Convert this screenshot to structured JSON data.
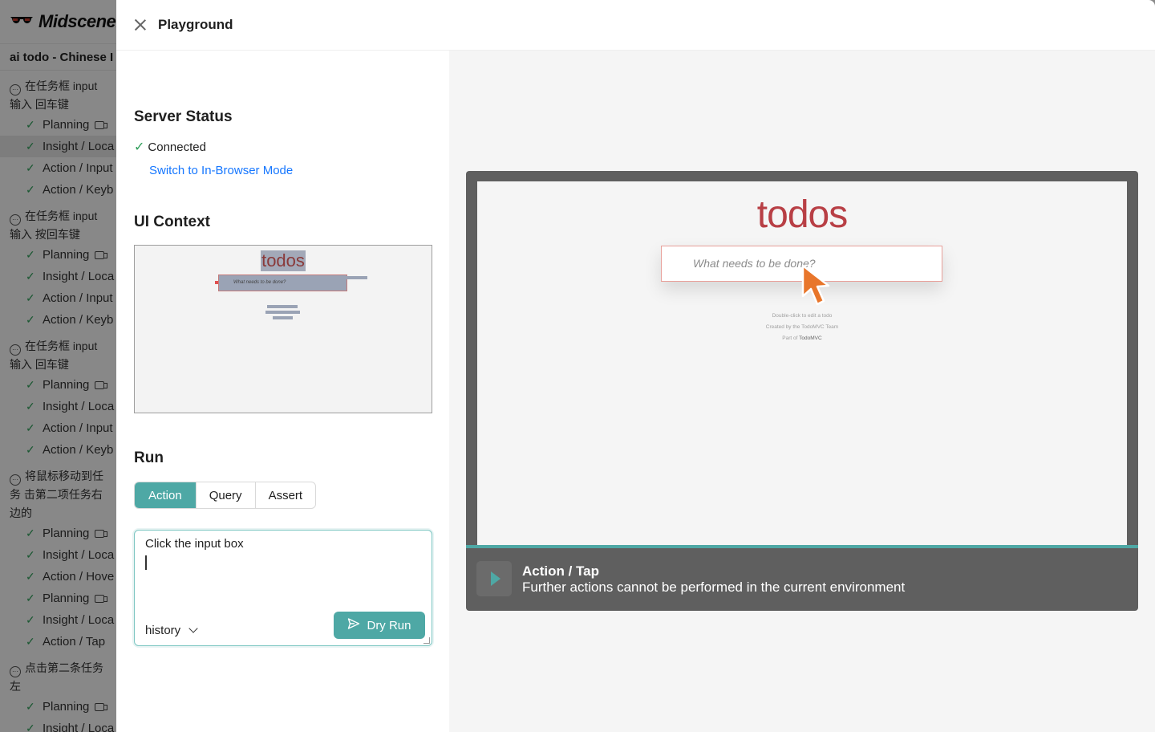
{
  "background": {
    "brand": "Midscene.",
    "report_title": "ai todo - Chinese I",
    "task_groups": [
      {
        "title": "在任务框 input 输入 回车键",
        "items": [
          {
            "label": "Planning",
            "cam": true,
            "selected": false
          },
          {
            "label": "Insight / Loca",
            "cam": false,
            "selected": true
          },
          {
            "label": "Action / Input",
            "cam": false,
            "selected": false
          },
          {
            "label": "Action / Keyb",
            "cam": false,
            "selected": false
          }
        ]
      },
      {
        "title": "在任务框 input 输入 按回车键",
        "items": [
          {
            "label": "Planning",
            "cam": true,
            "selected": false
          },
          {
            "label": "Insight / Loca",
            "cam": false,
            "selected": false
          },
          {
            "label": "Action / Input",
            "cam": false,
            "selected": false
          },
          {
            "label": "Action / Keyb",
            "cam": false,
            "selected": false
          }
        ]
      },
      {
        "title": "在任务框 input 输入 回车键",
        "items": [
          {
            "label": "Planning",
            "cam": true,
            "selected": false
          },
          {
            "label": "Insight / Loca",
            "cam": false,
            "selected": false
          },
          {
            "label": "Action / Input",
            "cam": false,
            "selected": false
          },
          {
            "label": "Action / Keyb",
            "cam": false,
            "selected": false
          }
        ]
      },
      {
        "title": "将鼠标移动到任务 击第二项任务右边的",
        "items": [
          {
            "label": "Planning",
            "cam": true,
            "selected": false
          },
          {
            "label": "Insight / Loca",
            "cam": false,
            "selected": false
          },
          {
            "label": "Action / Hove",
            "cam": false,
            "selected": false
          },
          {
            "label": "Planning",
            "cam": true,
            "selected": false
          },
          {
            "label": "Insight / Loca",
            "cam": false,
            "selected": false
          },
          {
            "label": "Action / Tap",
            "cam": false,
            "selected": false
          }
        ]
      },
      {
        "title": "点击第二条任务左",
        "items": [
          {
            "label": "Planning",
            "cam": true,
            "selected": false
          },
          {
            "label": "Insight / Loca",
            "cam": false,
            "selected": false
          }
        ]
      }
    ]
  },
  "drawer": {
    "title": "Playground"
  },
  "server_status": {
    "heading": "Server Status",
    "status": "Connected",
    "switch_link": "Switch to In-Browser Mode"
  },
  "ui_context": {
    "heading": "UI Context",
    "thumb_title": "todos",
    "thumb_placeholder": "What needs to be done?"
  },
  "run": {
    "heading": "Run",
    "modes": [
      "Action",
      "Query",
      "Assert"
    ],
    "active_mode": "Action",
    "prompt_value": "Click the input box",
    "history_label": "history",
    "dry_run_label": "Dry Run"
  },
  "player": {
    "app_title": "todos",
    "input_placeholder": "What needs to be done?",
    "footer_line1": "Double-click to edit a todo",
    "footer_line2": "Created by the TodoMVC Team",
    "footer_line3_prefix": "Part of ",
    "footer_line3_link": "TodoMVC",
    "step_title": "Action / Tap",
    "step_subtitle": "Further actions cannot be performed in the current environment",
    "progress_fraction": 1.0
  },
  "colors": {
    "accent": "#4ea8a5",
    "link": "#1677ff",
    "success": "#2f9e5a",
    "todos_red": "#b83f45",
    "cursor_orange": "#e8762b"
  }
}
